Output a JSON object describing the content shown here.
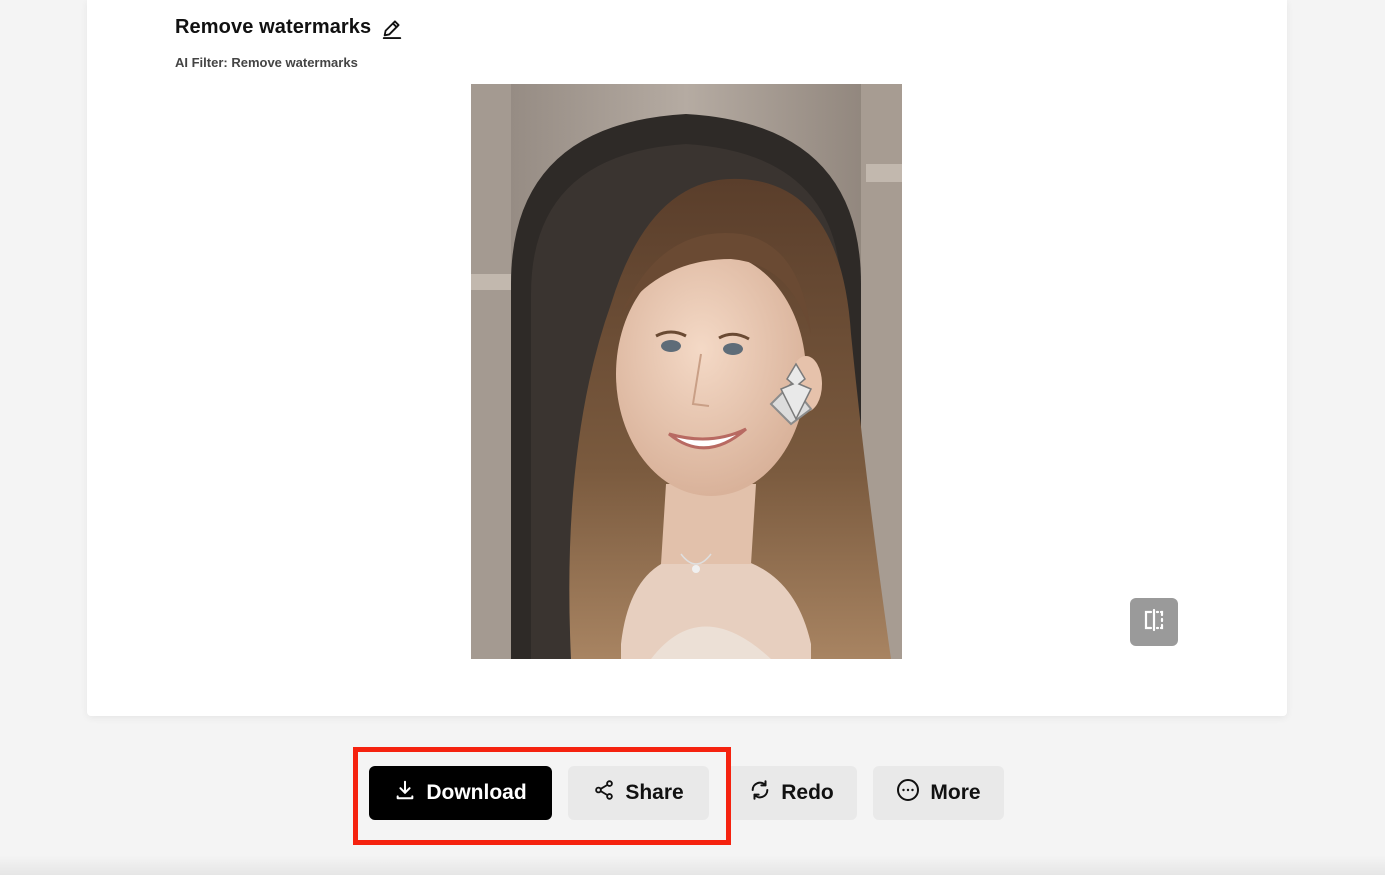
{
  "header": {
    "title": "Remove watermarks",
    "subtitle": "AI Filter: Remove watermarks"
  },
  "image": {
    "alt": "Edited portrait photo of a smiling woman with long hair in front of a stone arch"
  },
  "actions": {
    "download_label": "Download",
    "share_label": "Share",
    "redo_label": "Redo",
    "more_label": "More"
  },
  "icons": {
    "edit": "pencil-icon",
    "compare": "compare-split-icon",
    "download": "download-icon",
    "share": "share-icon",
    "redo": "redo-icon",
    "more": "more-icon"
  },
  "colors": {
    "primary_button": "#000000",
    "secondary_button": "#e9e9e9",
    "highlight": "#f5220f",
    "background": "#f4f4f4"
  }
}
